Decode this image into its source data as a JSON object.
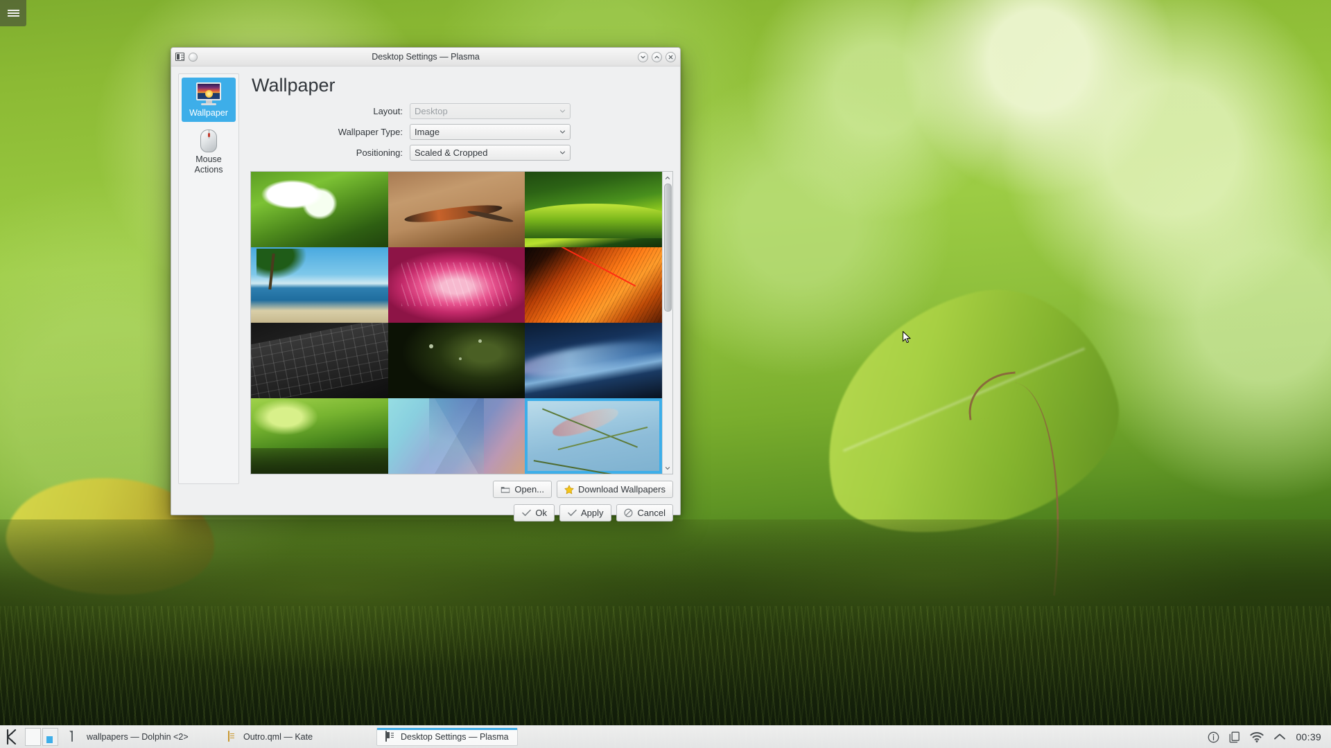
{
  "window": {
    "title": "Desktop Settings — Plasma",
    "titlebar_icons": [
      "window-menu-icon",
      "help-orb-icon"
    ],
    "controls": {
      "minimize": "minimize-button",
      "maximize": "maximize-button",
      "close": "close-button"
    }
  },
  "sidebar": {
    "items": [
      {
        "label": "Wallpaper",
        "icon": "monitor-wallpaper-icon",
        "selected": true
      },
      {
        "label": "Mouse Actions",
        "icon": "mouse-icon",
        "selected": false
      }
    ]
  },
  "main": {
    "page_title": "Wallpaper",
    "form": [
      {
        "label": "Layout:",
        "value": "Desktop",
        "disabled": true,
        "name": "layout-combo"
      },
      {
        "label": "Wallpaper Type:",
        "value": "Image",
        "disabled": false,
        "name": "wallpaper-type-combo"
      },
      {
        "label": "Positioning:",
        "value": "Scaled & Cropped",
        "disabled": false,
        "name": "positioning-combo"
      }
    ],
    "thumbnails": [
      {
        "id": 1,
        "name": "white-flower",
        "selected": false
      },
      {
        "id": 2,
        "name": "lizard-on-sand",
        "selected": false
      },
      {
        "id": 3,
        "name": "green-leaf-curve",
        "selected": false
      },
      {
        "id": 4,
        "name": "palm-beach",
        "selected": false
      },
      {
        "id": 5,
        "name": "pink-flower-macro",
        "selected": false
      },
      {
        "id": 6,
        "name": "orange-fabric-threads",
        "selected": false
      },
      {
        "id": 7,
        "name": "black-keyboard",
        "selected": false
      },
      {
        "id": 8,
        "name": "dew-on-dark-leaf",
        "selected": false
      },
      {
        "id": 9,
        "name": "blue-light-wave",
        "selected": false
      },
      {
        "id": 10,
        "name": "green-leaves-moss",
        "selected": false
      },
      {
        "id": 11,
        "name": "abstract-triangles",
        "selected": false
      },
      {
        "id": 12,
        "name": "grass-seedhead-sky",
        "selected": true
      }
    ],
    "file_buttons": [
      {
        "label": "Open...",
        "icon": "folder-icon",
        "name": "open-button"
      },
      {
        "label": "Download Wallpapers",
        "icon": "star-icon",
        "name": "download-wallpapers-button"
      }
    ],
    "dialog_buttons": [
      {
        "label": "Ok",
        "icon": "check-icon",
        "name": "ok-button"
      },
      {
        "label": "Apply",
        "icon": "check-icon",
        "name": "apply-button"
      },
      {
        "label": "Cancel",
        "icon": "cancel-icon",
        "name": "cancel-button"
      }
    ]
  },
  "taskbar": {
    "launcher": "kde-k-menu-icon",
    "tasks": [
      {
        "label": "wallpapers — Dolphin <2>",
        "icon": "dolphin-icon",
        "active": false
      },
      {
        "label": "Outro.qml  — Kate",
        "icon": "kate-icon",
        "active": false
      },
      {
        "label": "Desktop Settings — Plasma",
        "icon": "plasma-settings-icon",
        "active": true
      }
    ],
    "tray": [
      "info-icon",
      "clipboard-icon",
      "wifi-icon",
      "chevron-up-icon"
    ],
    "clock": "00:39"
  },
  "colors": {
    "accent": "#3daee9",
    "window_bg": "#eff0f1",
    "text": "#31363b",
    "disabled_text": "#9a9fa3"
  }
}
